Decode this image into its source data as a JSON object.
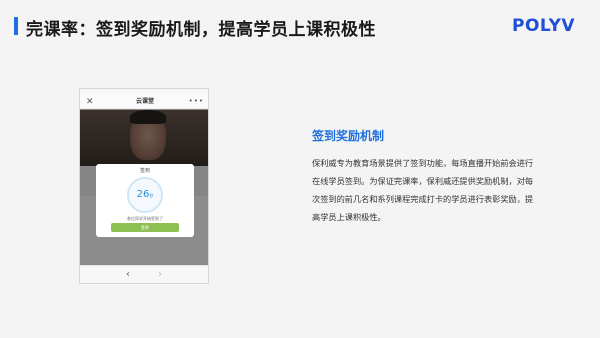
{
  "header": {
    "title": "完课率：签到奖励机制，提高学员上课积极性",
    "logo_text": "POLYV",
    "accent_color": "#1f6fde"
  },
  "phone": {
    "nav": {
      "close_icon": "close-icon",
      "title": "云课堂",
      "more_icon": "more-icon"
    },
    "modal": {
      "title": "签到",
      "countdown_value": "26",
      "countdown_unit": "秒",
      "message": "各位同学开始签到了",
      "button_label": "签到",
      "button_color": "#8cc152"
    },
    "bottom_nav": {
      "back_icon": "chevron-left-icon",
      "forward_icon": "chevron-right-icon"
    }
  },
  "feature": {
    "heading": "签到奖励机制",
    "body": "保利威专为教育场景提供了签到功能，每场直播开始前会进行在线学员签到。为保证完课率，保利威还提供奖励机制，对每次签到的前几名和系列课程完成打卡的学员进行表彰奖励，提高学员上课积极性。"
  }
}
